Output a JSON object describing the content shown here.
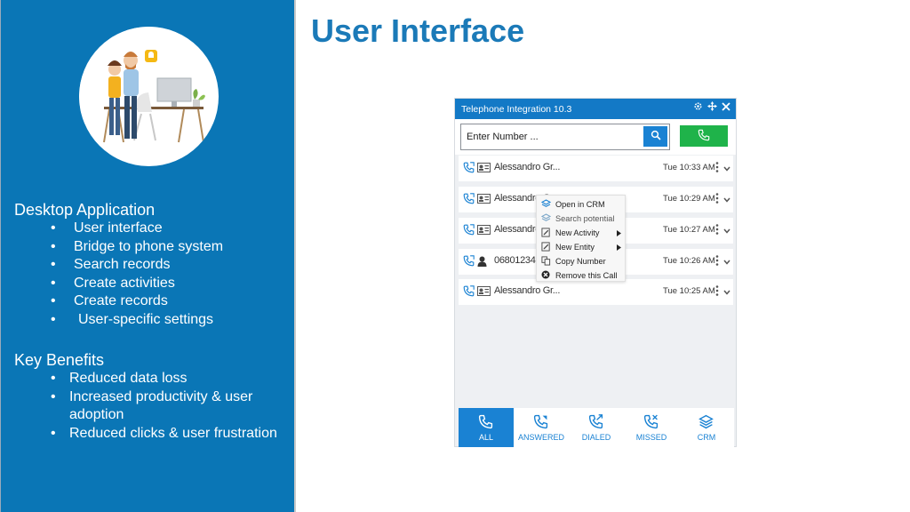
{
  "slide": {
    "title": "User Interface"
  },
  "sidebar": {
    "desktop_title": "Desktop Application",
    "desktop_items": [
      "User interface",
      "Bridge to phone system",
      "Search records",
      "Create activities",
      "Create records",
      "User-specific settings"
    ],
    "benefits_title": "Key Benefits",
    "benefit_items": [
      "Reduced data loss",
      "Increased productivity & user adoption",
      "Reduced clicks & user frustration"
    ],
    "bullet": "•",
    "panel_color": "#0a76b6"
  },
  "app": {
    "title": "Telephone Integration 10.3",
    "titlebar_icons": [
      "gear-icon",
      "move-icon",
      "close-icon"
    ],
    "number_placeholder": "Enter Number ...",
    "accent_color": "#1379c6",
    "call_button_color": "#1fb34a",
    "calls": [
      {
        "name": "Alessandro Gr...",
        "time": "Tue 10:33 AM",
        "contact_icon": "contact-card-icon"
      },
      {
        "name": "Alessandro Gr...",
        "time": "Tue 10:29 AM",
        "contact_icon": "contact-card-icon"
      },
      {
        "name": "Alessandro Gr...",
        "time": "Tue 10:27 AM",
        "contact_icon": "contact-card-icon"
      },
      {
        "name": "06801234",
        "time": "Tue 10:26 AM",
        "contact_icon": "unknown-person-icon"
      },
      {
        "name": "Alessandro Gr...",
        "time": "Tue 10:25 AM",
        "contact_icon": "contact-card-icon"
      }
    ],
    "context_menu": [
      {
        "label": "Open in CRM",
        "icon": "layers-icon",
        "submenu": false,
        "disabled": false
      },
      {
        "label": "Search potential",
        "icon": "layers-icon",
        "submenu": false,
        "disabled": true
      },
      {
        "label": "New Activity",
        "icon": "edit-icon",
        "submenu": true,
        "disabled": false
      },
      {
        "label": "New Entity",
        "icon": "edit-icon",
        "submenu": true,
        "disabled": false
      },
      {
        "label": "Copy Number",
        "icon": "copy-icon",
        "submenu": false,
        "disabled": false
      },
      {
        "label": "Remove this Call",
        "icon": "remove-icon",
        "submenu": false,
        "disabled": false
      }
    ],
    "tabs": [
      {
        "label": "ALL",
        "icon": "phone-icon",
        "active": true
      },
      {
        "label": "ANSWERED",
        "icon": "phone-incoming-icon",
        "active": false
      },
      {
        "label": "DIALED",
        "icon": "phone-outgoing-icon",
        "active": false
      },
      {
        "label": "MISSED",
        "icon": "phone-missed-icon",
        "active": false
      },
      {
        "label": "CRM",
        "icon": "layers-icon",
        "active": false
      }
    ]
  }
}
